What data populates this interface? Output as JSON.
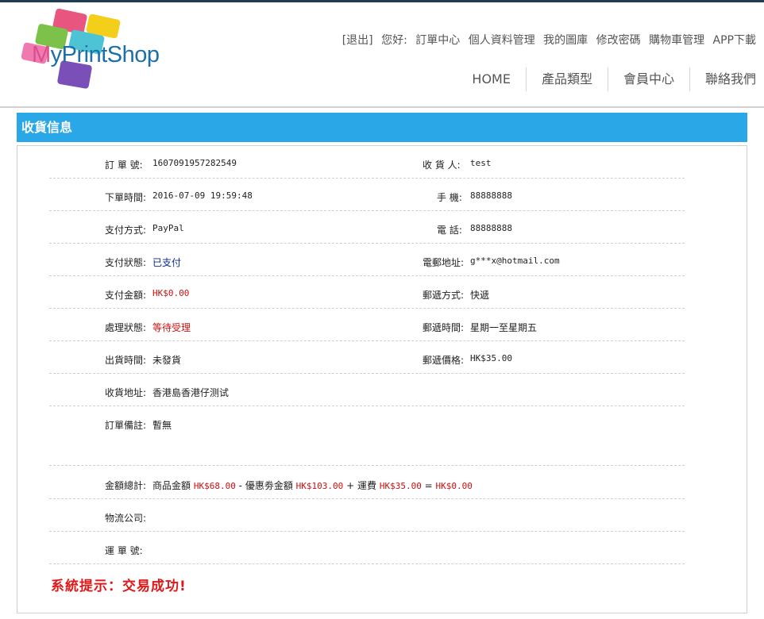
{
  "header": {
    "logo_text_m": "M",
    "logo_text_rest": "yPrintShop",
    "top_links": {
      "logout": "[退出]",
      "greeting": "您好:",
      "orders": "訂單中心",
      "profile": "個人資料管理",
      "gallery": "我的圖庫",
      "change_password": "修改密碼",
      "cart": "購物車管理",
      "app": "APP下載"
    },
    "nav": [
      "HOME",
      "產品類型",
      "會員中心",
      "聯絡我們"
    ]
  },
  "section_title": "收貨信息",
  "order": {
    "order_no_label": "訂 單 號:",
    "order_no": "1607091957282549",
    "receiver_label": "收 貨 人:",
    "receiver": "test",
    "order_time_label": "下單時間:",
    "order_time": "2016-07-09 19:59:48",
    "mobile_label": "手  機:",
    "mobile": "88888888",
    "payment_method_label": "支付方式:",
    "payment_method": "PayPal",
    "phone_label": "電  話:",
    "phone": "88888888",
    "payment_status_label": "支付狀態:",
    "payment_status": "已支付",
    "email_label": "電郵地址:",
    "email": "g***x@hotmail.com",
    "payment_amount_label": "支付金額:",
    "payment_amount": "HK$0.00",
    "shipping_method_label": "郵遞方式:",
    "shipping_method": "快遞",
    "process_status_label": "處理狀態:",
    "process_status": "等待受理",
    "shipping_time_label": "郵遞時間:",
    "shipping_time": "星期一至星期五",
    "ship_time_label": "出貨時間:",
    "ship_time": "未發貨",
    "shipping_price_label": "郵遞價格:",
    "shipping_price": "HK$35.00",
    "address_label": "收貨地址:",
    "address": "香港島香港仔测试",
    "note_label": "訂單備註:",
    "note": "暫無",
    "total_label": "金額總計:",
    "goods_label": "商品金額",
    "goods_amount": "HK$68.00",
    "minus": "-",
    "coupon_label": "優惠劵金額",
    "coupon_amount": "HK$103.00",
    "plus": "+",
    "freight_label": "運費",
    "freight_amount": "HK$35.00",
    "equals": "=",
    "total_amount": "HK$0.00",
    "logistics_label": "物流公司:",
    "logistics": "",
    "tracking_label": "運 單 號:",
    "tracking": ""
  },
  "system_message": "系統提示：交易成功!",
  "colors": {
    "accent": "#29a7e6",
    "paid": "#0b2a8f",
    "amount_red": "#cc1111",
    "success_red": "#dd1a1a"
  }
}
